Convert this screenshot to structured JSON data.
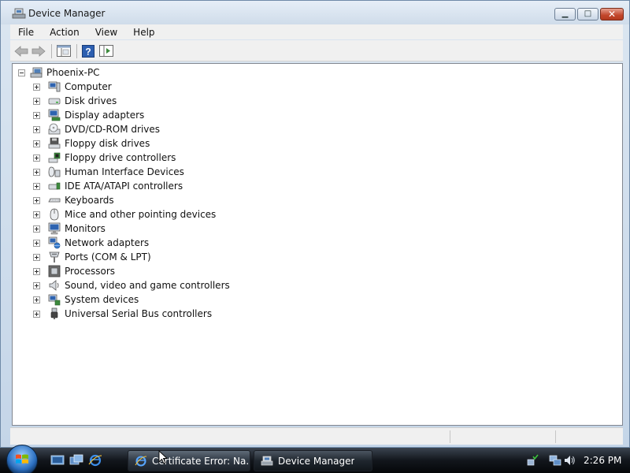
{
  "window": {
    "title": "Device Manager"
  },
  "menu": [
    "File",
    "Action",
    "View",
    "Help"
  ],
  "tree": {
    "root": "Phoenix-PC",
    "children": [
      {
        "label": "Computer",
        "icon": "computer-icon"
      },
      {
        "label": "Disk drives",
        "icon": "disk-drive-icon"
      },
      {
        "label": "Display adapters",
        "icon": "display-adapter-icon"
      },
      {
        "label": "DVD/CD-ROM drives",
        "icon": "dvd-drive-icon"
      },
      {
        "label": "Floppy disk drives",
        "icon": "floppy-drive-icon"
      },
      {
        "label": "Floppy drive controllers",
        "icon": "floppy-controller-icon"
      },
      {
        "label": "Human Interface Devices",
        "icon": "hid-icon"
      },
      {
        "label": "IDE ATA/ATAPI controllers",
        "icon": "ide-controller-icon"
      },
      {
        "label": "Keyboards",
        "icon": "keyboard-icon"
      },
      {
        "label": "Mice and other pointing devices",
        "icon": "mouse-icon"
      },
      {
        "label": "Monitors",
        "icon": "monitor-icon"
      },
      {
        "label": "Network adapters",
        "icon": "network-adapter-icon"
      },
      {
        "label": "Ports (COM & LPT)",
        "icon": "port-icon"
      },
      {
        "label": "Processors",
        "icon": "processor-icon"
      },
      {
        "label": "Sound, video and game controllers",
        "icon": "sound-icon"
      },
      {
        "label": "System devices",
        "icon": "system-devices-icon"
      },
      {
        "label": "Universal Serial Bus controllers",
        "icon": "usb-icon"
      }
    ]
  },
  "taskbar": {
    "buttons": [
      {
        "label": "Certificate Error: Na...",
        "icon": "internet-explorer-icon"
      },
      {
        "label": "Device Manager",
        "icon": "device-manager-icon"
      }
    ],
    "clock": "2:26 PM"
  }
}
